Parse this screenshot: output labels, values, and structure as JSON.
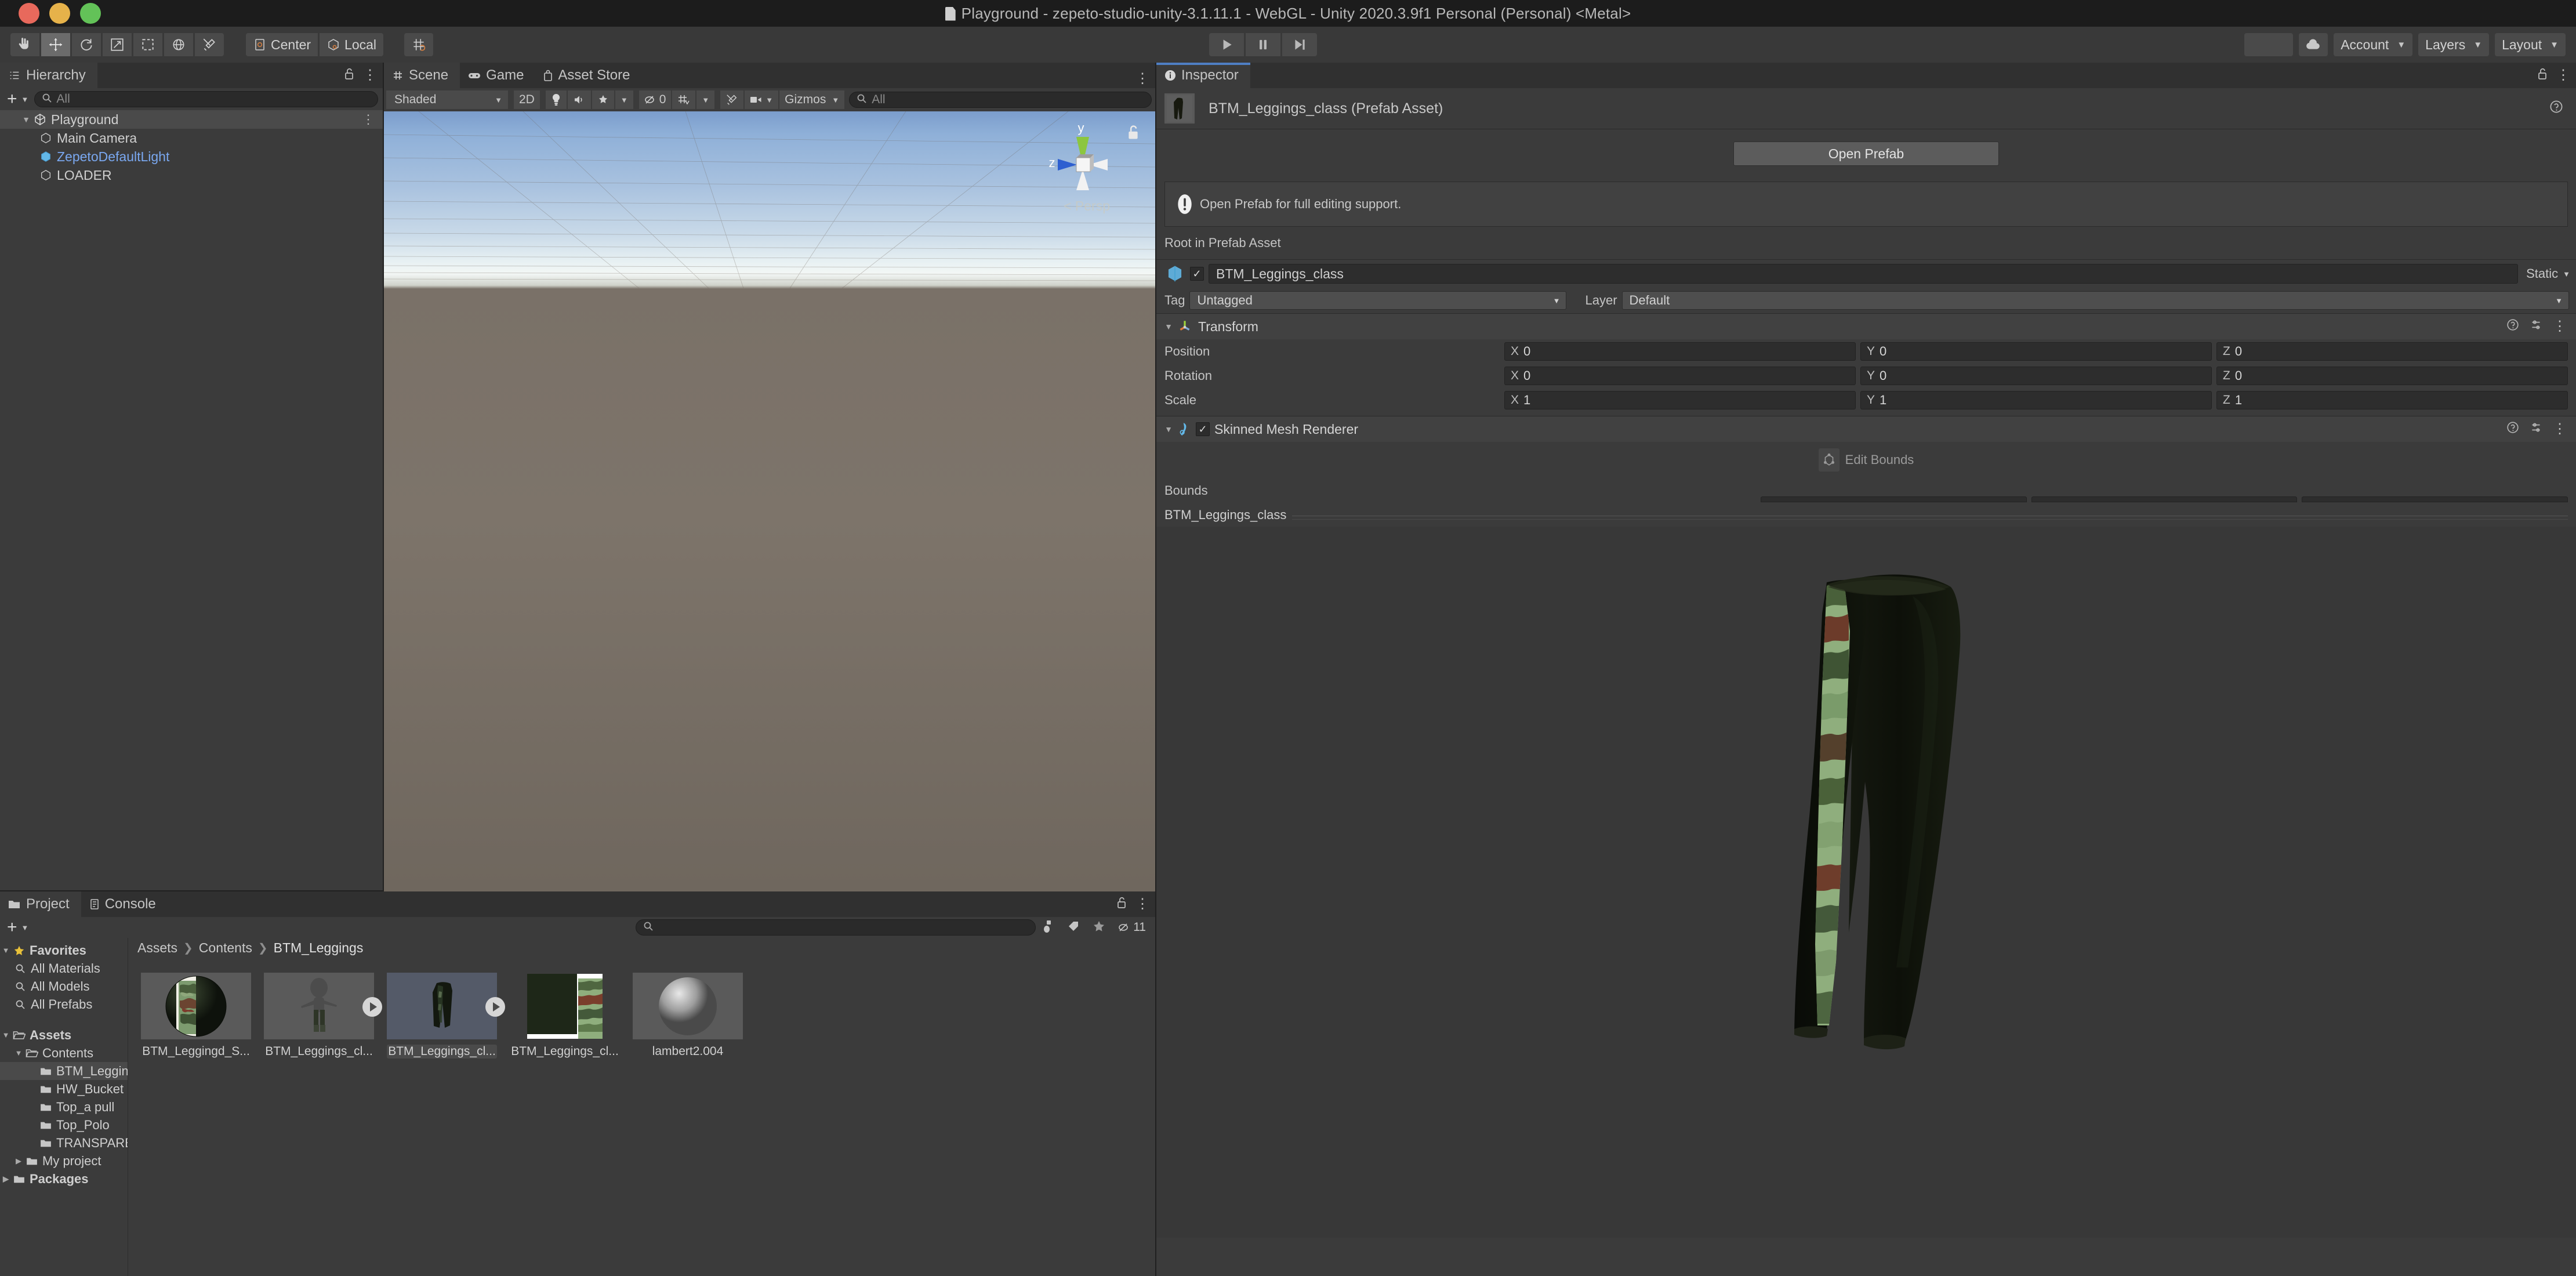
{
  "window": {
    "title": "Playground - zepeto-studio-unity-3.1.11.1 - WebGL - Unity 2020.3.9f1 Personal (Personal) <Metal>"
  },
  "toolbar": {
    "tools": [
      {
        "name": "hand-tool",
        "glyph": "hand"
      },
      {
        "name": "move-tool",
        "glyph": "move"
      },
      {
        "name": "rotate-tool",
        "glyph": "rotate"
      },
      {
        "name": "scale-tool",
        "glyph": "scale"
      },
      {
        "name": "rect-tool",
        "glyph": "rect"
      },
      {
        "name": "transform-tool",
        "glyph": "transform"
      },
      {
        "name": "custom-tool",
        "glyph": "wrench"
      }
    ],
    "pivot_label": "Center",
    "space_label": "Local",
    "play_label": "play",
    "pause_label": "pause",
    "step_label": "step",
    "cloud_label": "cloud",
    "account_label": "Account",
    "layers_label": "Layers",
    "layout_label": "Layout"
  },
  "hierarchy": {
    "tab_label": "Hierarchy",
    "search_placeholder": "All",
    "items": [
      {
        "label": "Playground",
        "depth": 0,
        "selected": true,
        "expanded": true,
        "icon": "unity-scene-icon"
      },
      {
        "label": "Main Camera",
        "depth": 1,
        "selected": false,
        "icon": "gameobject-icon"
      },
      {
        "label": "ZepetoDefaultLight",
        "depth": 1,
        "selected": false,
        "icon": "prefab-icon",
        "blue": true
      },
      {
        "label": "LOADER",
        "depth": 1,
        "selected": false,
        "icon": "gameobject-icon"
      }
    ]
  },
  "scene": {
    "tabs": [
      {
        "label": "Scene",
        "active": true,
        "icon": "scene-grid-icon"
      },
      {
        "label": "Game",
        "active": false,
        "icon": "game-pad-icon"
      },
      {
        "label": "Asset Store",
        "active": false,
        "icon": "asset-store-icon"
      }
    ],
    "draw_mode": "Shaded",
    "two_d_label": "2D",
    "effects_count": "0",
    "gizmos_label": "Gizmos",
    "search_placeholder": "All",
    "axis_y_label": "y",
    "axis_z_label": "z",
    "persp_label": "< Persp"
  },
  "inspector": {
    "tab_label": "Inspector",
    "header_title": "BTM_Leggings_class (Prefab Asset)",
    "open_prefab_button": "Open Prefab",
    "help_message": "Open Prefab for full editing support.",
    "root_label": "Root in Prefab Asset",
    "object_name": "BTM_Leggings_class",
    "static_label": "Static",
    "tag_label": "Tag",
    "tag_value": "Untagged",
    "layer_label": "Layer",
    "layer_value": "Default",
    "transform": {
      "title": "Transform",
      "rows": [
        {
          "label": "Position",
          "x": "0",
          "y": "0",
          "z": "0"
        },
        {
          "label": "Rotation",
          "x": "0",
          "y": "0",
          "z": "0"
        },
        {
          "label": "Scale",
          "x": "1",
          "y": "1",
          "z": "1"
        }
      ],
      "axis_labels": [
        "X",
        "Y",
        "Z"
      ]
    },
    "skinned_mesh_renderer": {
      "title": "Skinned Mesh Renderer",
      "edit_bounds_label": "Edit Bounds",
      "bounds_label": "Bounds"
    },
    "asset_name_bar": "BTM_Leggings_class"
  },
  "project": {
    "tabs": [
      {
        "label": "Project",
        "active": true,
        "icon": "folder-icon"
      },
      {
        "label": "Console",
        "active": false,
        "icon": "console-icon"
      }
    ],
    "search_placeholder": "",
    "item_count": "11",
    "breadcrumb": [
      "Assets",
      "Contents",
      "BTM_Leggings"
    ],
    "tree": [
      {
        "label": "Favorites",
        "indent": 0,
        "tri": "down",
        "icon": "star-icon",
        "bold": true
      },
      {
        "label": "All Materials",
        "indent": 1,
        "tri": "",
        "icon": "search-icon"
      },
      {
        "label": "All Models",
        "indent": 1,
        "tri": "",
        "icon": "search-icon"
      },
      {
        "label": "All Prefabs",
        "indent": 1,
        "tri": "",
        "icon": "search-icon"
      },
      {
        "label": "SPACER",
        "indent": 0,
        "tri": "",
        "icon": "spacer"
      },
      {
        "label": "Assets",
        "indent": 0,
        "tri": "down",
        "icon": "folder-open-icon",
        "bold": true
      },
      {
        "label": "Contents",
        "indent": 1,
        "tri": "down",
        "icon": "folder-open-icon"
      },
      {
        "label": "BTM_Leggings",
        "indent": 2,
        "tri": "",
        "icon": "folder-icon",
        "selected": true
      },
      {
        "label": "HW_Bucket",
        "indent": 2,
        "tri": "",
        "icon": "folder-icon"
      },
      {
        "label": "Top_a pull",
        "indent": 2,
        "tri": "",
        "icon": "folder-icon"
      },
      {
        "label": "Top_Polo",
        "indent": 2,
        "tri": "",
        "icon": "folder-icon"
      },
      {
        "label": "TRANSPARENT",
        "indent": 2,
        "tri": "",
        "icon": "folder-icon"
      },
      {
        "label": "My project",
        "indent": 1,
        "tri": "right",
        "icon": "folder-icon"
      },
      {
        "label": "Packages",
        "indent": 0,
        "tri": "right",
        "icon": "folder-icon",
        "bold": true
      }
    ],
    "assets": [
      {
        "name": "BTM_Leggingd_S...",
        "type": "material-sphere-camo",
        "has_play": false,
        "selected": false
      },
      {
        "name": "BTM_Leggings_cl...",
        "type": "model-character",
        "has_play": true,
        "selected": false
      },
      {
        "name": "BTM_Leggings_cl...",
        "type": "prefab-leggings",
        "has_play": true,
        "selected": true
      },
      {
        "name": "BTM_Leggings_cl...",
        "type": "texture-camo",
        "has_play": false,
        "selected": false
      },
      {
        "name": "lambert2.004",
        "type": "material-sphere-grey",
        "has_play": false,
        "selected": false
      }
    ]
  },
  "colors": {
    "accent_blue": "#4f7fc4",
    "panel_bg": "#3b3b3b",
    "toolbar_bg": "#393939",
    "titlebar_bg": "#1c1c1c",
    "text": "#c8c8c8",
    "selection": "#4a4a4a",
    "hierarchy_link": "#7aa8f0"
  }
}
